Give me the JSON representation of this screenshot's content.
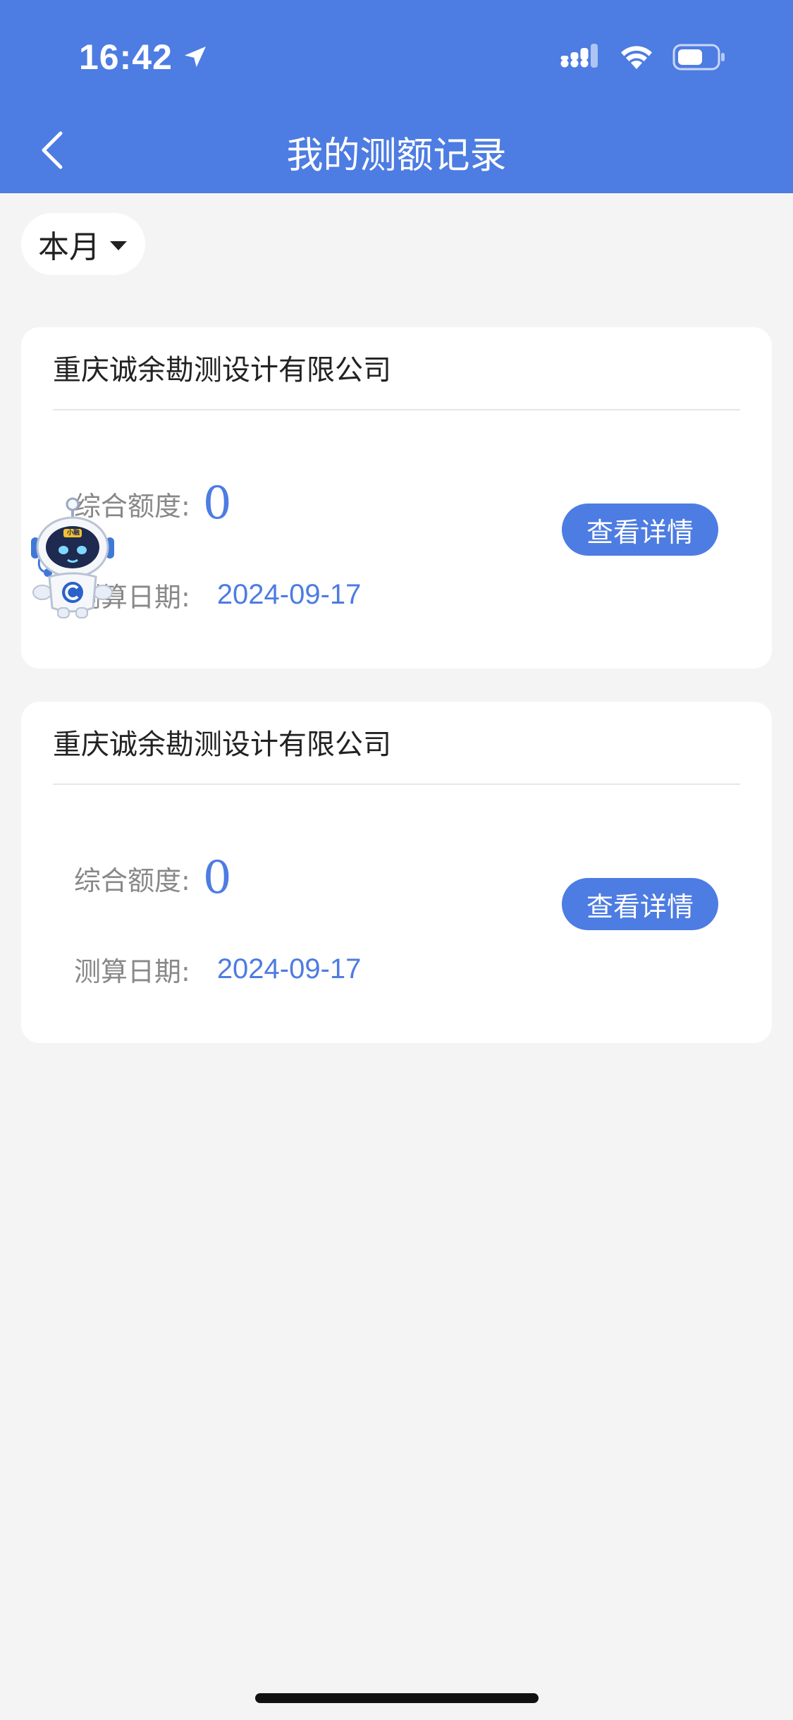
{
  "status_bar": {
    "time": "16:42"
  },
  "header": {
    "title": "我的测额记录"
  },
  "filter": {
    "label": "本月"
  },
  "records": [
    {
      "company": "重庆诚余勘测设计有限公司",
      "amount_label": "综合额度:",
      "amount": "0",
      "date_label": "测算日期:",
      "date": "2024-09-17",
      "button": "查看详情"
    },
    {
      "company": "重庆诚余勘测设计有限公司",
      "amount_label": "综合额度:",
      "amount": "0",
      "date_label": "测算日期:",
      "date": "2024-09-17",
      "button": "查看详情"
    }
  ],
  "mascot": {
    "badge": "小融"
  },
  "colors": {
    "primary": "#4d7ce2",
    "background": "#f4f4f4",
    "card": "#ffffff",
    "label": "#888888"
  },
  "icons": [
    "location-arrow-icon",
    "cellular-signal-icon",
    "wifi-icon",
    "battery-icon",
    "back-chevron-icon",
    "dropdown-caret-icon",
    "robot-mascot-icon"
  ]
}
